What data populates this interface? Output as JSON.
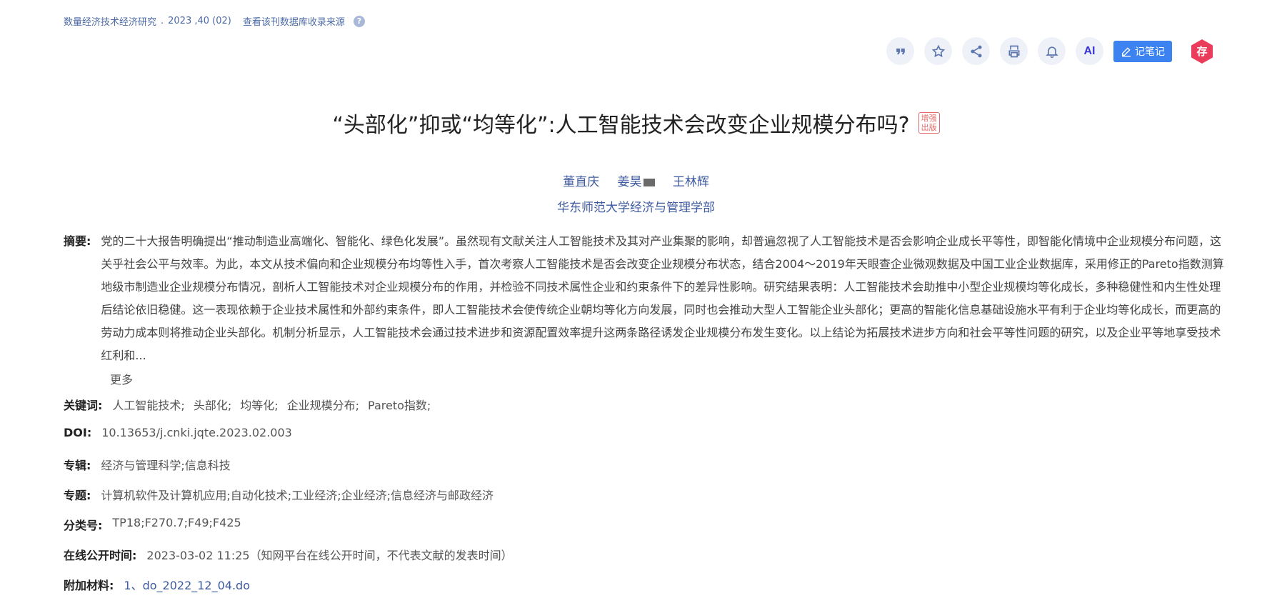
{
  "source": {
    "journal": "数量经济技术经济研究",
    "issue": "2023 ,40 (02)",
    "db_link": "查看该刊数据库收录来源",
    "help": "?"
  },
  "toolbar": {
    "ai_label": "AI",
    "note_label": "记笔记",
    "save_label": "存"
  },
  "title": {
    "text": "“头部化”抑或“均等化”:人工智能技术会改变企业规模分布吗?",
    "badge_line1": "增强",
    "badge_line2": "出版"
  },
  "authors": [
    "董直庆",
    "姜昊",
    "王林辉"
  ],
  "affiliation": "华东师范大学经济与管理学部",
  "abstract": {
    "label": "摘要:",
    "text": "党的二十大报告明确提出“推动制造业高端化、智能化、绿色化发展”。虽然现有文献关注人工智能技术及其对产业集聚的影响，却普遍忽视了人工智能技术是否会影响企业成长平等性，即智能化情境中企业规模分布问题，这关乎社会公平与效率。为此，本文从技术偏向和企业规模分布均等性入手，首次考察人工智能技术是否会改变企业规模分布状态，结合2004～2019年天眼查企业微观数据及中国工业企业数据库，采用修正的Pareto指数测算地级市制造业企业规模分布情况，剖析人工智能技术对企业规模分布的作用，并检验不同技术属性企业和约束条件下的差异性影响。研究结果表明：人工智能技术会助推中小型企业规模均等化成长，多种稳健性和内生性处理后结论依旧稳健。这一表现依赖于企业技术属性和外部约束条件，即人工智能技术会使传统企业朝均等化方向发展，同时也会推动大型人工智能企业头部化；更高的智能化信息基础设施水平有利于企业均等化成长，而更高的劳动力成本则将推动企业头部化。机制分析显示，人工智能技术会通过技术进步和资源配置效率提升这两条路径诱发企业规模分布发生变化。以上结论为拓展技术进步方向和社会平等性问题的研究，以及企业平等地享受技术红利和...",
    "more": "更多"
  },
  "keywords": {
    "label": "关键词:",
    "items": [
      "人工智能技术;",
      "头部化;",
      "均等化;",
      "企业规模分布;",
      "Pareto指数;"
    ]
  },
  "doi": {
    "label": "DOI:",
    "value": "10.13653/j.cnki.jqte.2023.02.003"
  },
  "series": {
    "label": "专辑:",
    "value": "经济与管理科学;信息科技"
  },
  "subject": {
    "label": "专题:",
    "value": "计算机软件及计算机应用;自动化技术;工业经济;企业经济;信息经济与邮政经济"
  },
  "classification": {
    "label": "分类号:",
    "value": "TP18;F270.7;F49;F425"
  },
  "online_time": {
    "label": "在线公开时间:",
    "value": "2023-03-02 11:25（知网平台在线公开时间，不代表文献的发表时间）"
  },
  "attachment": {
    "label": "附加材料:",
    "value": "1、do_2022_12_04.do"
  }
}
